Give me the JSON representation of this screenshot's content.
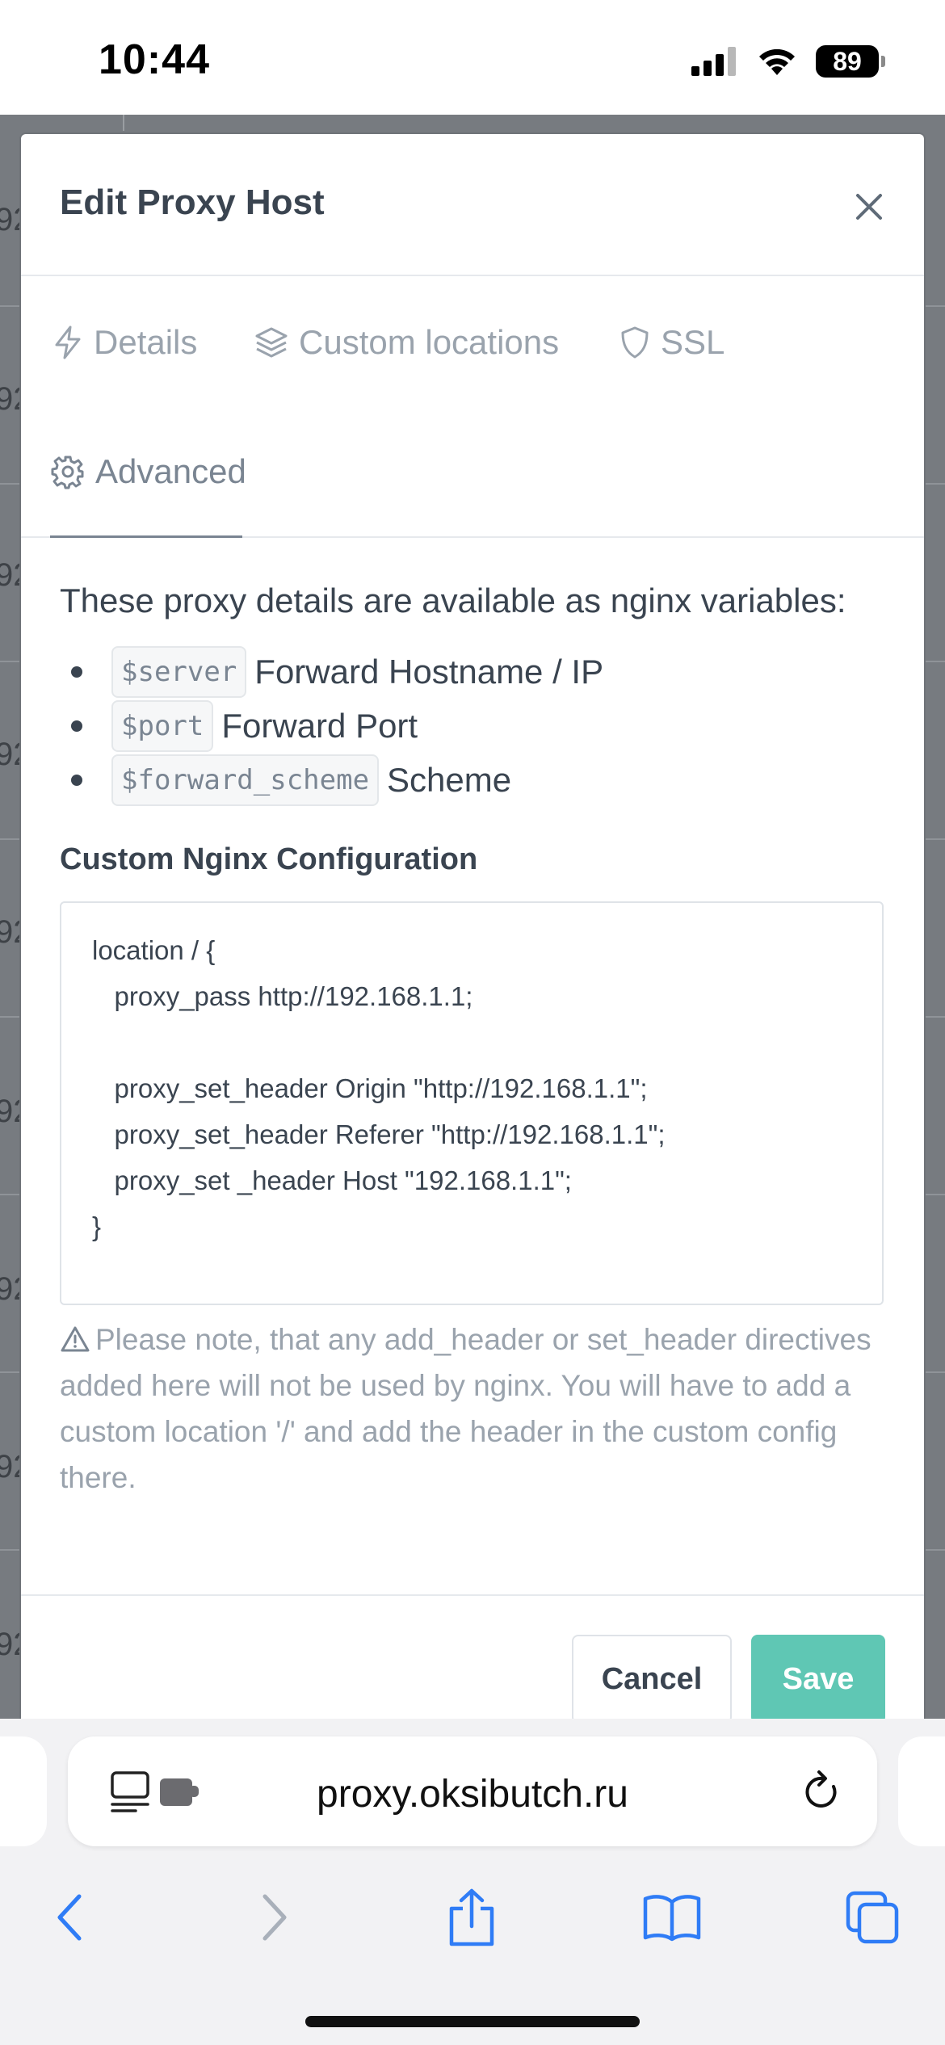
{
  "status_bar": {
    "time": "10:44",
    "battery": "89"
  },
  "background": {
    "row_label": "92"
  },
  "modal": {
    "title": "Edit Proxy Host",
    "tabs": [
      {
        "label": "Details",
        "icon": "bolt-icon"
      },
      {
        "label": "Custom locations",
        "icon": "layers-icon"
      },
      {
        "label": "SSL",
        "icon": "shield-icon"
      },
      {
        "label": "Advanced",
        "icon": "gear-icon",
        "active": true
      }
    ],
    "intro": "These proxy details are available as nginx variables:",
    "variables": [
      {
        "code": "$server",
        "desc": "Forward Hostname / IP"
      },
      {
        "code": "$port",
        "desc": "Forward Port"
      },
      {
        "code": "$forward_scheme",
        "desc": "Scheme"
      }
    ],
    "config_label": "Custom Nginx Configuration",
    "config_value": "location / {\n   proxy_pass http://192.168.1.1;\n\n   proxy_set_header Origin \"http://192.168.1.1\";\n   proxy_set_header Referer \"http://192.168.1.1\";\n   proxy_set _header Host \"192.168.1.1\";\n}",
    "note": "Please note, that any add_header or set_header directives added here will not be used by nginx. You will have to add a custom location '/' and add the header in the custom config there.",
    "cancel_label": "Cancel",
    "save_label": "Save",
    "colors": {
      "save": "#5fc7b4",
      "text": "#3a4450",
      "muted": "#9aa3ad"
    }
  },
  "browser": {
    "url": "proxy.oksibutch.ru",
    "accent": "#2f7cf6"
  }
}
